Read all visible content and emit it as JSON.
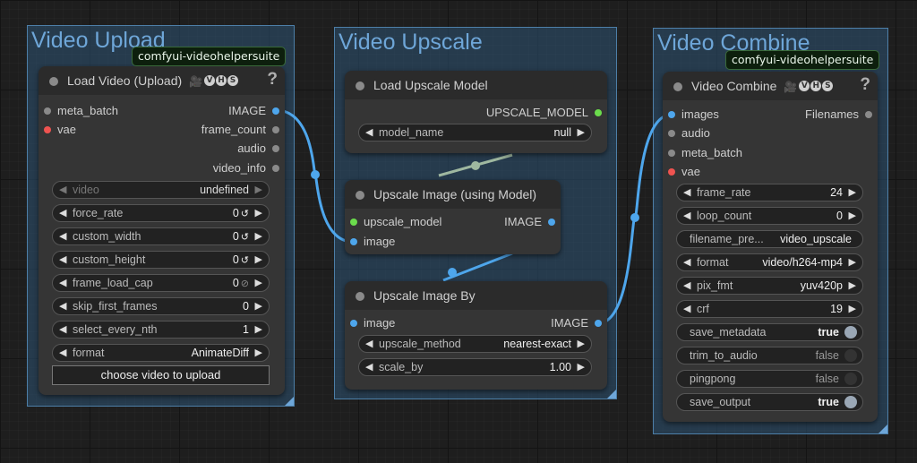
{
  "groups": {
    "video_upload": {
      "title": "Video Upload",
      "badge": "comfyui-videohelpersuite"
    },
    "video_upscale": {
      "title": "Video Upscale"
    },
    "video_combine": {
      "title": "Video Combine",
      "badge": "comfyui-videohelpersuite"
    }
  },
  "vhs_badge": {
    "emoji": "🎥",
    "letters": [
      "V",
      "H",
      "S"
    ]
  },
  "help_glyph": "?",
  "nodes": {
    "load_video": {
      "title": "Load Video (Upload)",
      "inputs": [
        "meta_batch",
        "vae"
      ],
      "outputs": [
        "IMAGE",
        "frame_count",
        "audio",
        "video_info"
      ],
      "widgets": [
        {
          "label": "video",
          "value": "undefined"
        },
        {
          "label": "force_rate",
          "value": "0"
        },
        {
          "label": "custom_width",
          "value": "0"
        },
        {
          "label": "custom_height",
          "value": "0"
        },
        {
          "label": "frame_load_cap",
          "value": "0"
        },
        {
          "label": "skip_first_frames",
          "value": "0"
        },
        {
          "label": "select_every_nth",
          "value": "1"
        },
        {
          "label": "format",
          "value": "AnimateDiff"
        }
      ],
      "reset_glyph": "↺",
      "disabled_glyph": "⊘",
      "upload_button": "choose video to upload"
    },
    "load_upscale_model": {
      "title": "Load Upscale Model",
      "outputs": [
        "UPSCALE_MODEL"
      ],
      "widgets": [
        {
          "label": "model_name",
          "value": "null"
        }
      ]
    },
    "upscale_image_model": {
      "title": "Upscale Image (using Model)",
      "inputs": [
        "upscale_model",
        "image"
      ],
      "outputs": [
        "IMAGE"
      ]
    },
    "upscale_image_by": {
      "title": "Upscale Image By",
      "inputs": [
        "image"
      ],
      "outputs": [
        "IMAGE"
      ],
      "widgets": [
        {
          "label": "upscale_method",
          "value": "nearest-exact"
        },
        {
          "label": "scale_by",
          "value": "1.00"
        }
      ]
    },
    "video_combine": {
      "title": "Video Combine",
      "inputs": [
        "images",
        "audio",
        "meta_batch",
        "vae"
      ],
      "outputs": [
        "Filenames"
      ],
      "widgets": [
        {
          "label": "frame_rate",
          "value": "24"
        },
        {
          "label": "loop_count",
          "value": "0"
        },
        {
          "label": "filename_pre...",
          "value": "video_upscale"
        },
        {
          "label": "format",
          "value": "video/h264-mp4"
        },
        {
          "label": "pix_fmt",
          "value": "yuv420p"
        },
        {
          "label": "crf",
          "value": "19"
        },
        {
          "label": "save_metadata",
          "value": "true"
        },
        {
          "label": "trim_to_audio",
          "value": "false"
        },
        {
          "label": "pingpong",
          "value": "false"
        },
        {
          "label": "save_output",
          "value": "true"
        }
      ]
    }
  },
  "colors": {
    "image_link": "#4ea6ec",
    "model_link": "#9fb8a0",
    "slot_input": "#8a8a8a",
    "slot_vae": "#ef5350",
    "slot_model": "#6bdc4c",
    "group_title": "#6ea6d8"
  }
}
